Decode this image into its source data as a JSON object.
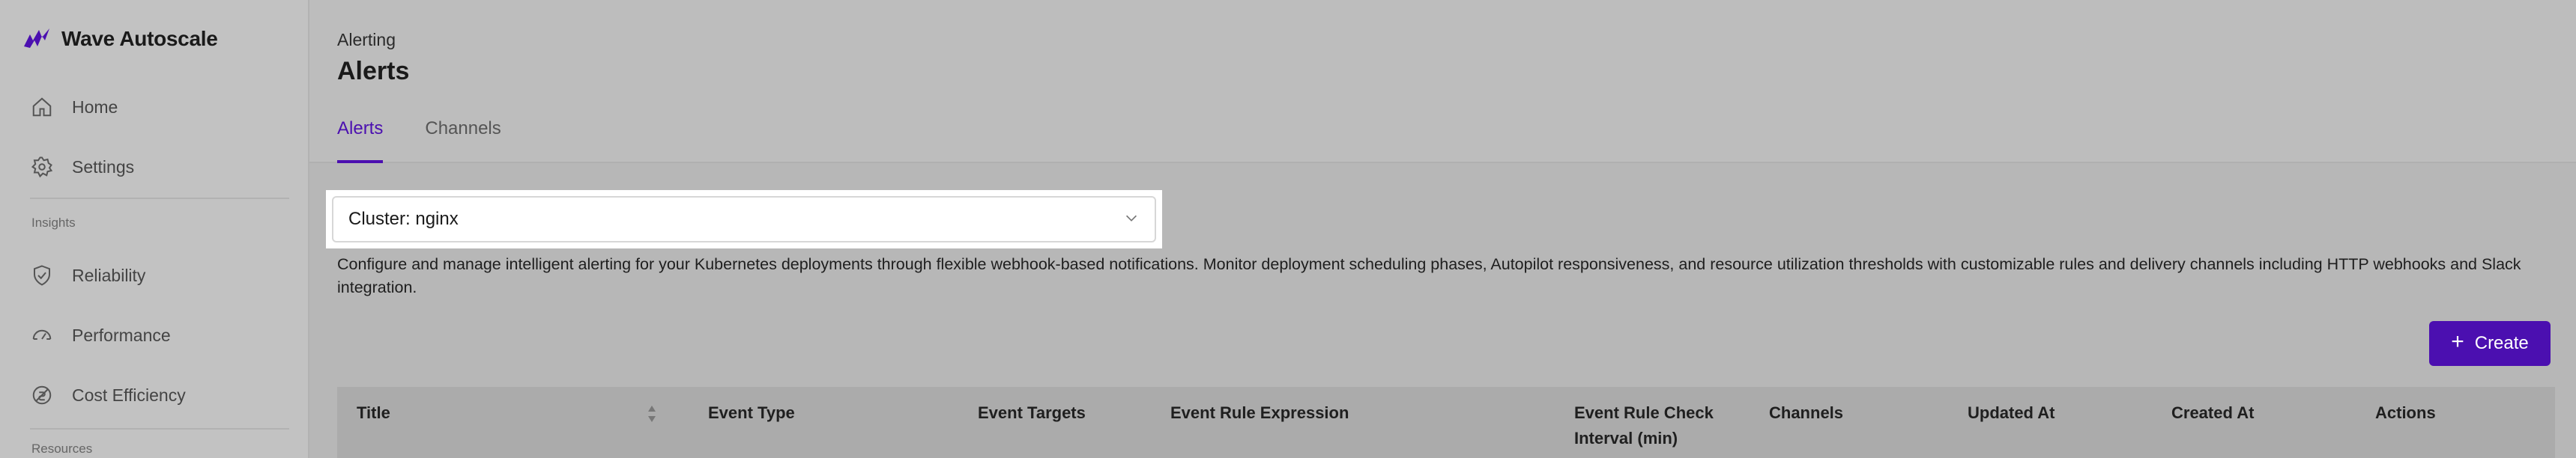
{
  "app": {
    "name": "Wave Autoscale"
  },
  "sidebar": {
    "items": [
      {
        "label": "Home",
        "icon": "home-icon"
      },
      {
        "label": "Settings",
        "icon": "gear-icon"
      },
      {
        "label": "Reliability",
        "icon": "shield-check-icon"
      },
      {
        "label": "Performance",
        "icon": "speedometer-icon"
      },
      {
        "label": "Cost Efficiency",
        "icon": "cost-icon"
      }
    ],
    "sections": {
      "insights": "Insights",
      "resources": "Resources"
    }
  },
  "header": {
    "breadcrumb": "Alerting",
    "title": "Alerts",
    "tabs": [
      {
        "label": "Alerts",
        "active": true
      },
      {
        "label": "Channels",
        "active": false
      }
    ]
  },
  "main": {
    "cluster_select": {
      "value": "Cluster: nginx"
    },
    "description": "Configure and manage intelligent alerting for your Kubernetes deployments through flexible webhook-based notifications. Monitor deployment scheduling phases, Autopilot responsiveness, and resource utilization thresholds with customizable rules and delivery channels including HTTP webhooks and Slack integration.",
    "create_label": "Create",
    "table": {
      "columns": [
        "Title",
        "Event Type",
        "Event Targets",
        "Event Rule Expression",
        "Event Rule Check Interval (min)",
        "Channels",
        "Updated At",
        "Created At",
        "Actions"
      ]
    }
  },
  "colors": {
    "accent": "#4b0fb0",
    "overlay_background": "#bdbdbd"
  }
}
